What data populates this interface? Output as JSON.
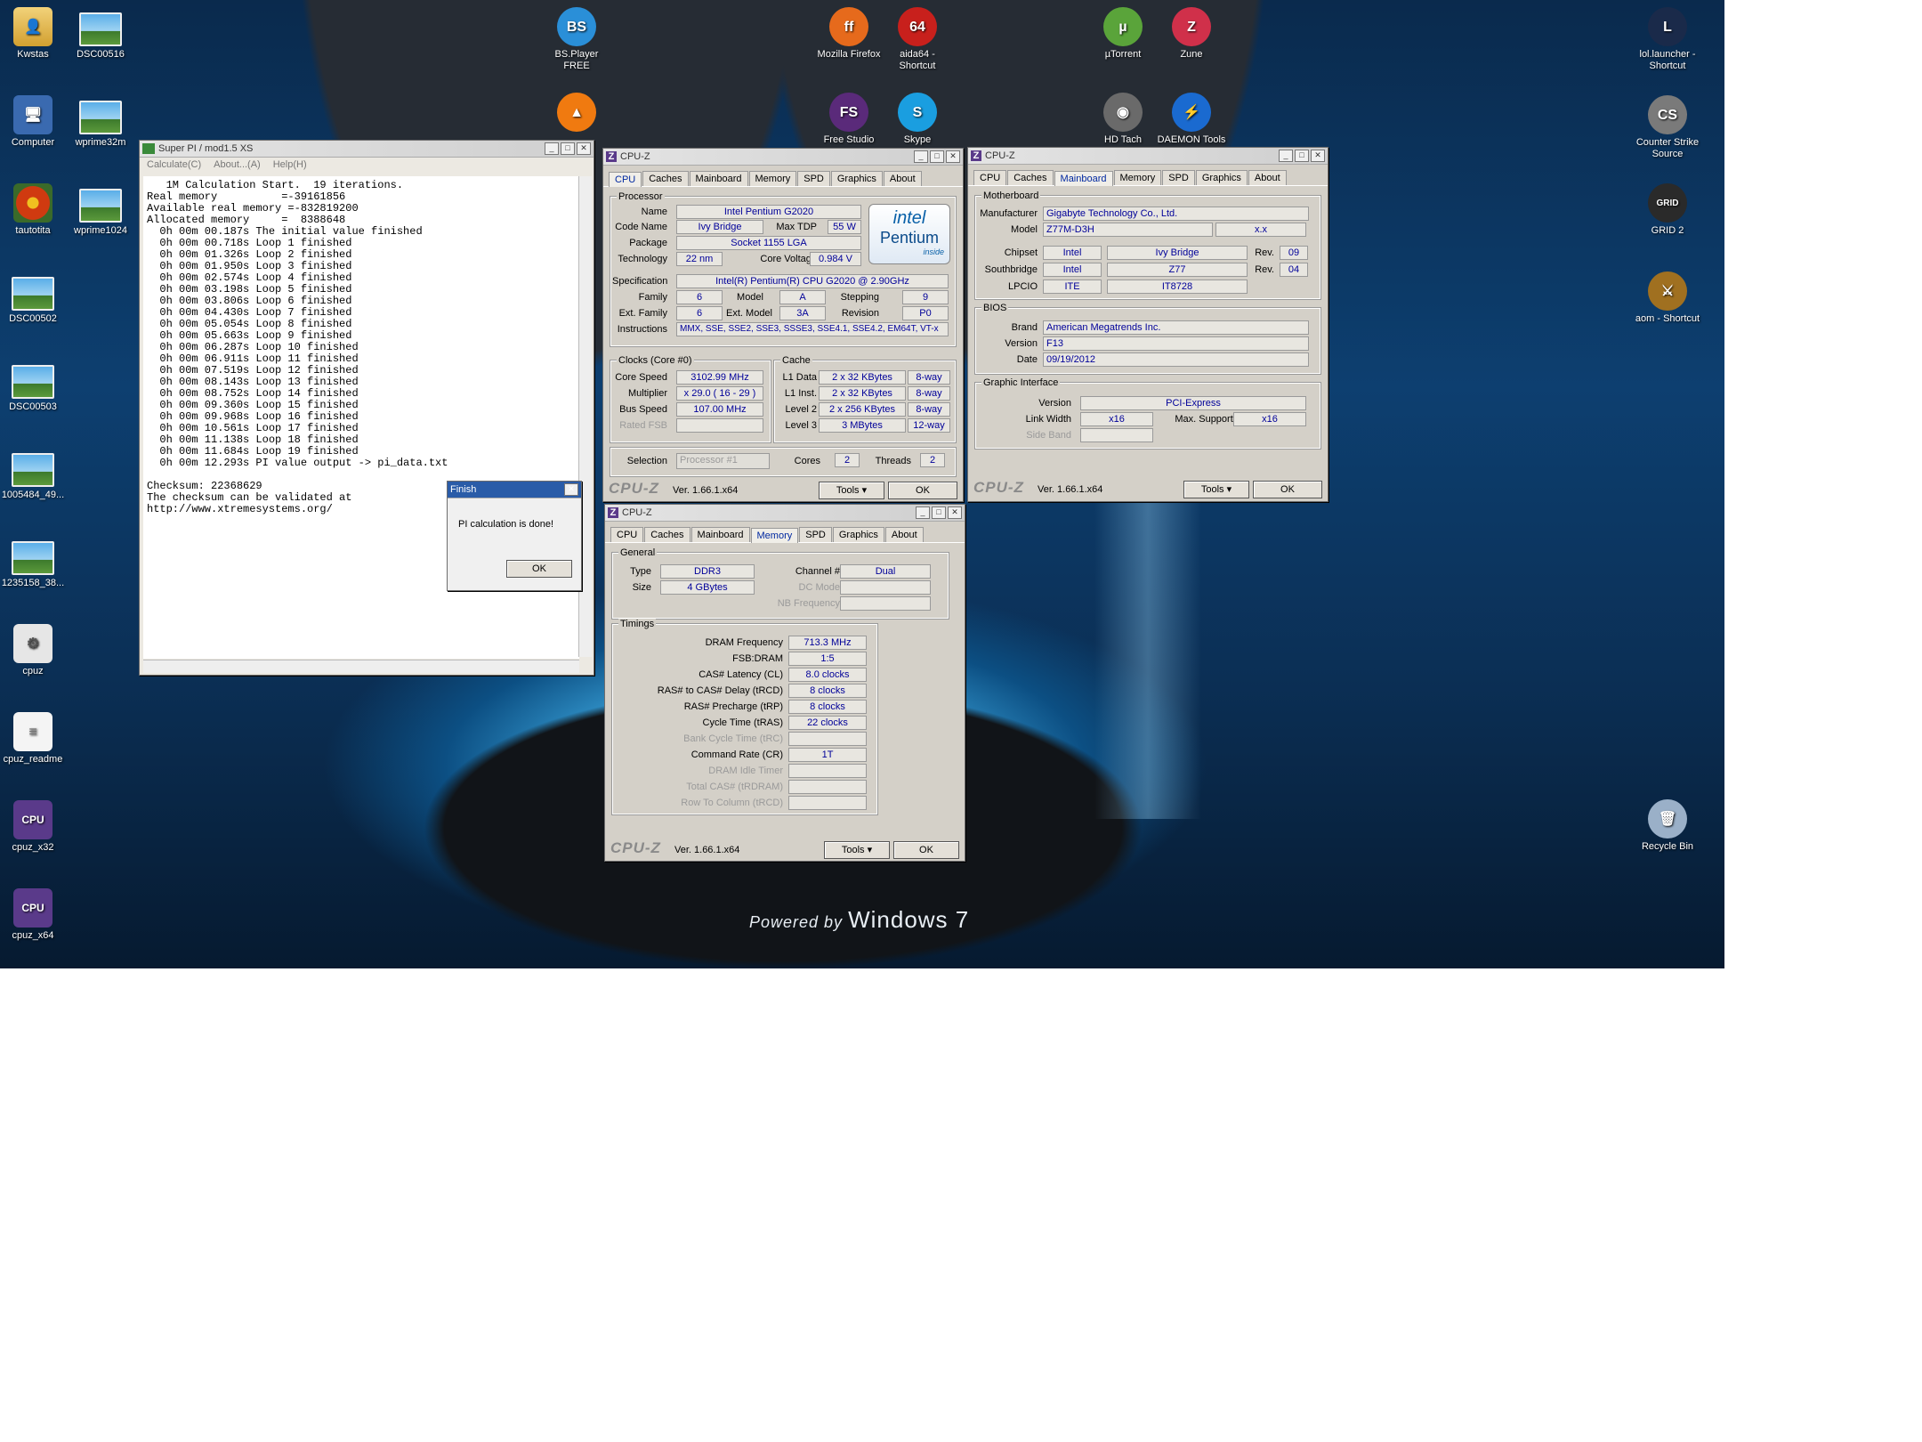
{
  "desktop": {
    "left_icons": [
      {
        "label": "Kwstas",
        "icon": "folder-user-icon"
      },
      {
        "label": "DSC00516",
        "icon": "photo-icon"
      },
      {
        "label": "Computer",
        "icon": "computer-icon"
      },
      {
        "label": "wprime32m",
        "icon": "photo-icon"
      },
      {
        "label": "tautotita",
        "icon": "flowers-photo-icon"
      },
      {
        "label": "wprime1024",
        "icon": "photo-icon"
      },
      {
        "label": "DSC00502",
        "icon": "photo-icon"
      },
      {
        "label": "DSC00503",
        "icon": "photo-icon"
      },
      {
        "label": "1005484_49...",
        "icon": "photo-icon"
      },
      {
        "label": "1235158_38...",
        "icon": "photo-icon"
      },
      {
        "label": "cpuz",
        "icon": "settings-file-icon"
      },
      {
        "label": "cpuz_readme",
        "icon": "text-file-icon"
      },
      {
        "label": "cpuz_x32",
        "icon": "cpuz-app-icon"
      },
      {
        "label": "cpuz_x64",
        "icon": "cpuz-app-icon"
      }
    ],
    "top_icons": [
      {
        "label": "BS.Player FREE",
        "glyph": "BS",
        "color": "#2a8fd8"
      },
      {
        "label": "Mozilla Firefox",
        "glyph": "ff",
        "color": "#e66a1c"
      },
      {
        "label": "aida64 - Shortcut",
        "glyph": "64",
        "color": "#c8201c"
      },
      {
        "label": "µTorrent",
        "glyph": "µ",
        "color": "#5aa43a"
      },
      {
        "label": "Zune",
        "glyph": "Z",
        "color": "#d0304a"
      },
      {
        "label": "",
        "glyph": "▲",
        "color": "#f07a10"
      },
      {
        "label": "Free Studio",
        "glyph": "FS",
        "color": "#5a2a7a"
      },
      {
        "label": "Skype",
        "glyph": "S",
        "color": "#1a9ee0"
      },
      {
        "label": "HD Tach",
        "glyph": "◉",
        "color": "#6a6a6a"
      },
      {
        "label": "DAEMON Tools",
        "glyph": "⚡",
        "color": "#1a6ad0"
      }
    ],
    "right_icons": [
      {
        "label": "lol.launcher - Shortcut",
        "glyph": "L",
        "color": "#1a2a4a"
      },
      {
        "label": "Counter Strike Source",
        "glyph": "CS",
        "color": "#7a7a7a"
      },
      {
        "label": "GRID 2",
        "glyph": "GRID",
        "color": "#2a2a2a"
      },
      {
        "label": "aom - Shortcut",
        "glyph": "⚔",
        "color": "#a07020"
      },
      {
        "label": "Recycle Bin",
        "glyph": "🗑",
        "color": "#9ab0c8"
      }
    ],
    "brand_prefix": "Powered by",
    "brand_name": "Windows 7"
  },
  "superpi": {
    "title": "Super PI / mod1.5 XS",
    "menu": [
      "Calculate(C)",
      "About...(A)",
      "Help(H)"
    ],
    "lines": [
      "   1M Calculation Start.  19 iterations.",
      "Real memory          =-39161856",
      "Available real memory =-832819200",
      "Allocated memory     =  8388648",
      "  0h 00m 00.187s The initial value finished",
      "  0h 00m 00.718s Loop 1 finished",
      "  0h 00m 01.326s Loop 2 finished",
      "  0h 00m 01.950s Loop 3 finished",
      "  0h 00m 02.574s Loop 4 finished",
      "  0h 00m 03.198s Loop 5 finished",
      "  0h 00m 03.806s Loop 6 finished",
      "  0h 00m 04.430s Loop 7 finished",
      "  0h 00m 05.054s Loop 8 finished",
      "  0h 00m 05.663s Loop 9 finished",
      "  0h 00m 06.287s Loop 10 finished",
      "  0h 00m 06.911s Loop 11 finished",
      "  0h 00m 07.519s Loop 12 finished",
      "  0h 00m 08.143s Loop 13 finished",
      "  0h 00m 08.752s Loop 14 finished",
      "  0h 00m 09.360s Loop 15 finished",
      "  0h 00m 09.968s Loop 16 finished",
      "  0h 00m 10.561s Loop 17 finished",
      "  0h 00m 11.138s Loop 18 finished",
      "  0h 00m 11.684s Loop 19 finished",
      "  0h 00m 12.293s PI value output -> pi_data.txt",
      "",
      "Checksum: 22368629",
      "The checksum can be validated at",
      "http://www.xtremesystems.org/"
    ],
    "dialog": {
      "title": "Finish",
      "message": "PI calculation is done!",
      "ok": "OK"
    }
  },
  "cpuz_tabs": [
    "CPU",
    "Caches",
    "Mainboard",
    "Memory",
    "SPD",
    "Graphics",
    "About"
  ],
  "cpuz_common": {
    "title": "CPU-Z",
    "logo": "CPU-Z",
    "version": "Ver. 1.66.1.x64",
    "tools": "Tools",
    "ok": "OK"
  },
  "cpu": {
    "processor_label": "Processor",
    "name_l": "Name",
    "name": "Intel Pentium G2020",
    "codename_l": "Code Name",
    "codename": "Ivy Bridge",
    "tdp_l": "Max TDP",
    "tdp": "55 W",
    "package_l": "Package",
    "package": "Socket 1155 LGA",
    "tech_l": "Technology",
    "tech": "22 nm",
    "volt_l": "Core Voltage",
    "volt": "0.984 V",
    "spec_l": "Specification",
    "spec": "Intel(R) Pentium(R) CPU G2020 @ 2.90GHz",
    "family_l": "Family",
    "family": "6",
    "model_l": "Model",
    "model": "A",
    "stepping_l": "Stepping",
    "stepping": "9",
    "extfam_l": "Ext. Family",
    "extfam": "6",
    "extmod_l": "Ext. Model",
    "extmod": "3A",
    "rev_l": "Revision",
    "rev": "P0",
    "instr_l": "Instructions",
    "instr": "MMX, SSE, SSE2, SSE3, SSSE3, SSE4.1, SSE4.2, EM64T, VT-x",
    "badge_top": "intel",
    "badge_mid": "Pentium",
    "badge_bot": "inside",
    "clocks_label": "Clocks (Core #0)",
    "corespeed_l": "Core Speed",
    "corespeed": "3102.99 MHz",
    "mult_l": "Multiplier",
    "mult": "x 29.0 ( 16 - 29 )",
    "bus_l": "Bus Speed",
    "bus": "107.00 MHz",
    "fsb_l": "Rated FSB",
    "fsb": "",
    "cache_label": "Cache",
    "l1d_l": "L1 Data",
    "l1d": "2 x 32 KBytes",
    "l1d_w": "8-way",
    "l1i_l": "L1 Inst.",
    "l1i": "2 x 32 KBytes",
    "l1i_w": "8-way",
    "l2_l": "Level 2",
    "l2": "2 x 256 KBytes",
    "l2_w": "8-way",
    "l3_l": "Level 3",
    "l3": "3 MBytes",
    "l3_w": "12-way",
    "sel_l": "Selection",
    "sel": "Processor #1",
    "cores_l": "Cores",
    "cores": "2",
    "threads_l": "Threads",
    "threads": "2"
  },
  "mainboard": {
    "mb_label": "Motherboard",
    "manu_l": "Manufacturer",
    "manu": "Gigabyte Technology Co., Ltd.",
    "model_l": "Model",
    "model": "Z77M-D3H",
    "model_rev": "x.x",
    "chipset_l": "Chipset",
    "chipset": "Intel",
    "chipset_name": "Ivy Bridge",
    "rev_l": "Rev.",
    "chipset_rev": "09",
    "south_l": "Southbridge",
    "south": "Intel",
    "south_name": "Z77",
    "south_rev": "04",
    "lpcio_l": "LPCIO",
    "lpcio": "ITE",
    "lpcio_name": "IT8728",
    "bios_label": "BIOS",
    "brand_l": "Brand",
    "brand": "American Megatrends Inc.",
    "ver_l": "Version",
    "ver": "F13",
    "date_l": "Date",
    "date": "09/19/2012",
    "gi_label": "Graphic Interface",
    "gver_l": "Version",
    "gver": "PCI-Express",
    "lw_l": "Link Width",
    "lw": "x16",
    "ms_l": "Max. Supported",
    "ms": "x16",
    "sb_l": "Side Band"
  },
  "memory": {
    "gen_label": "General",
    "type_l": "Type",
    "type": "DDR3",
    "size_l": "Size",
    "size": "4 GBytes",
    "chan_l": "Channel #",
    "chan": "Dual",
    "dc_l": "DC Mode",
    "nb_l": "NB Frequency",
    "tim_label": "Timings",
    "timings": [
      {
        "l": "DRAM Frequency",
        "v": "713.3 MHz",
        "dim": false
      },
      {
        "l": "FSB:DRAM",
        "v": "1:5",
        "dim": false
      },
      {
        "l": "CAS# Latency (CL)",
        "v": "8.0 clocks",
        "dim": false
      },
      {
        "l": "RAS# to CAS# Delay (tRCD)",
        "v": "8 clocks",
        "dim": false
      },
      {
        "l": "RAS# Precharge (tRP)",
        "v": "8 clocks",
        "dim": false
      },
      {
        "l": "Cycle Time (tRAS)",
        "v": "22 clocks",
        "dim": false
      },
      {
        "l": "Bank Cycle Time (tRC)",
        "v": "",
        "dim": true
      },
      {
        "l": "Command Rate (CR)",
        "v": "1T",
        "dim": false
      },
      {
        "l": "DRAM Idle Timer",
        "v": "",
        "dim": true
      },
      {
        "l": "Total CAS# (tRDRAM)",
        "v": "",
        "dim": true
      },
      {
        "l": "Row To Column (tRCD)",
        "v": "",
        "dim": true
      }
    ]
  }
}
